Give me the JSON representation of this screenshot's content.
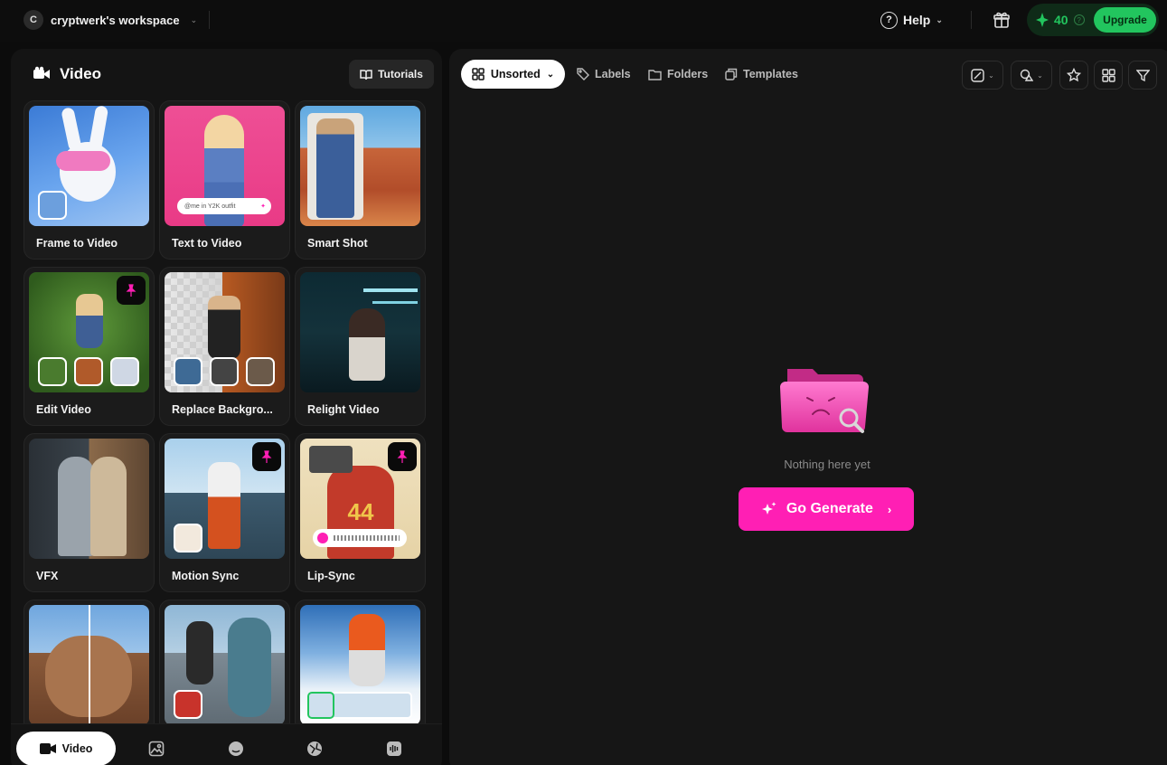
{
  "topbar": {
    "avatar_letter": "C",
    "workspace_name": "cryptwerk's workspace",
    "help_label": "Help",
    "credits": "40",
    "upgrade_label": "Upgrade"
  },
  "left_panel": {
    "title": "Video",
    "tutorials_label": "Tutorials",
    "cards": [
      {
        "label": "Frame to Video",
        "pinned": false
      },
      {
        "label": "Text to Video",
        "pinned": false,
        "overlay_text": "@me in Y2K outfit"
      },
      {
        "label": "Smart Shot",
        "pinned": false
      },
      {
        "label": "Edit Video",
        "pinned": true
      },
      {
        "label": "Replace Backgro...",
        "pinned": false
      },
      {
        "label": "Relight Video",
        "pinned": false
      },
      {
        "label": "VFX",
        "pinned": false
      },
      {
        "label": "Motion Sync",
        "pinned": true
      },
      {
        "label": "Lip-Sync",
        "pinned": true,
        "overlay_text": "44"
      },
      {
        "label": "",
        "pinned": false
      },
      {
        "label": "",
        "pinned": false
      },
      {
        "label": "",
        "pinned": false
      }
    ],
    "bottom_tabs": {
      "active_label": "Video",
      "icons": [
        "image-icon",
        "face-icon",
        "globe-icon",
        "audio-icon"
      ]
    }
  },
  "right_panel": {
    "sort_label": "Unsorted",
    "tabs": [
      "Labels",
      "Folders",
      "Templates"
    ],
    "empty_text": "Nothing here yet",
    "generate_label": "Go Generate"
  },
  "colors": {
    "accent_pink": "#ff1fb4",
    "credits_green": "#22c55e",
    "background": "#0c0c0c"
  }
}
